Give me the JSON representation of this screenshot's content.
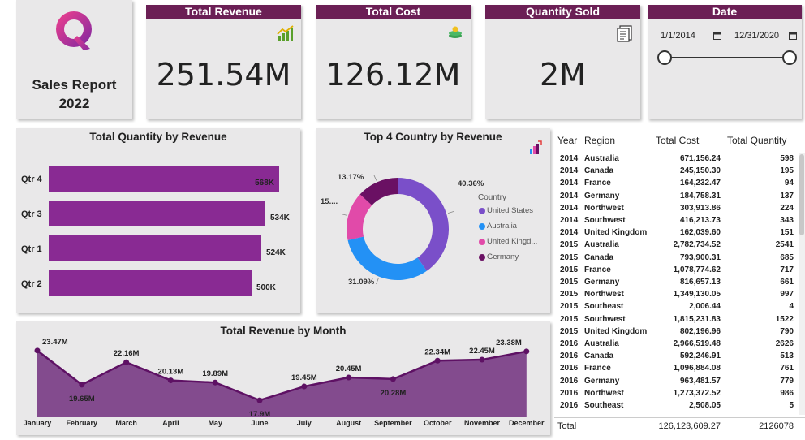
{
  "logo": {
    "title_line1": "Sales Report",
    "title_line2": "2022",
    "colors": [
      "#e43e8f",
      "#8a2a9f"
    ]
  },
  "kpis": {
    "revenue": {
      "label": "Total Revenue",
      "value": "251.54M",
      "icon": "revenue-chart-icon"
    },
    "cost": {
      "label": "Total Cost",
      "value": "126.12M",
      "icon": "coins-icon"
    },
    "quantity": {
      "label": "Quantity Sold",
      "value": "2M",
      "icon": "report-icon"
    }
  },
  "date_filter": {
    "label": "Date",
    "start": "1/1/2014",
    "end": "12/31/2020",
    "range_fraction": [
      0,
      1
    ]
  },
  "colors": {
    "header": "#6b1f55",
    "bar": "#892a93",
    "area": "#7a3d86",
    "line": "#5e1164"
  },
  "bar_chart": {
    "title": "Total Quantity by Revenue",
    "chart_data": {
      "type": "bar",
      "categories": [
        "Qtr 4",
        "Qtr 3",
        "Qtr 1",
        "Qtr 2"
      ],
      "values": [
        568,
        534,
        524,
        500
      ],
      "labels": [
        "568K",
        "534K",
        "524K",
        "500K"
      ],
      "ylabel": "",
      "xlabel": ""
    }
  },
  "donut_chart": {
    "title": "Top 4 Country by Revenue",
    "legend_title": "Country",
    "legend_items": [
      "United States",
      "Australia",
      "United Kingd...",
      "Germany"
    ],
    "labels": [
      "40.36%",
      "31.09%",
      "15....",
      "13.17%"
    ],
    "chart_data": {
      "type": "pie",
      "categories": [
        "United States",
        "Australia",
        "United Kingdom",
        "Germany"
      ],
      "values": [
        40.36,
        31.09,
        15.38,
        13.17
      ],
      "colors": [
        "#7a4fc9",
        "#2391f5",
        "#e14aa9",
        "#6a1063"
      ]
    }
  },
  "line_chart": {
    "title": "Total Revenue by Month",
    "chart_data": {
      "type": "area",
      "categories": [
        "January",
        "February",
        "March",
        "April",
        "May",
        "June",
        "July",
        "August",
        "September",
        "October",
        "November",
        "December"
      ],
      "values": [
        23.47,
        19.65,
        22.16,
        20.13,
        19.89,
        17.9,
        19.45,
        20.45,
        20.28,
        22.34,
        22.45,
        23.38
      ],
      "labels": [
        "23.47M",
        "19.65M",
        "22.16M",
        "20.13M",
        "19.89M",
        "17.9M",
        "19.45M",
        "20.45M",
        "20.28M",
        "22.34M",
        "22.45M",
        "23.38M"
      ]
    }
  },
  "table": {
    "headers": [
      "Year",
      "Region",
      "Total Cost",
      "Total Quantity"
    ],
    "rows": [
      [
        "2014",
        "Australia",
        "671,156.24",
        "598"
      ],
      [
        "2014",
        "Canada",
        "245,150.30",
        "195"
      ],
      [
        "2014",
        "France",
        "164,232.47",
        "94"
      ],
      [
        "2014",
        "Germany",
        "184,758.31",
        "137"
      ],
      [
        "2014",
        "Northwest",
        "303,913.86",
        "224"
      ],
      [
        "2014",
        "Southwest",
        "416,213.73",
        "343"
      ],
      [
        "2014",
        "United Kingdom",
        "162,039.60",
        "151"
      ],
      [
        "2015",
        "Australia",
        "2,782,734.52",
        "2541"
      ],
      [
        "2015",
        "Canada",
        "793,900.31",
        "685"
      ],
      [
        "2015",
        "France",
        "1,078,774.62",
        "717"
      ],
      [
        "2015",
        "Germany",
        "816,657.13",
        "661"
      ],
      [
        "2015",
        "Northwest",
        "1,349,130.05",
        "997"
      ],
      [
        "2015",
        "Southeast",
        "2,006.44",
        "4"
      ],
      [
        "2015",
        "Southwest",
        "1,815,231.83",
        "1522"
      ],
      [
        "2015",
        "United Kingdom",
        "802,196.96",
        "790"
      ],
      [
        "2016",
        "Australia",
        "2,966,519.48",
        "2626"
      ],
      [
        "2016",
        "Canada",
        "592,246.91",
        "513"
      ],
      [
        "2016",
        "France",
        "1,096,884.08",
        "761"
      ],
      [
        "2016",
        "Germany",
        "963,481.57",
        "779"
      ],
      [
        "2016",
        "Northwest",
        "1,273,372.52",
        "986"
      ],
      [
        "2016",
        "Southeast",
        "2,508.05",
        "5"
      ]
    ],
    "total": {
      "label": "Total",
      "cost": "126,123,609.27",
      "quantity": "2126078"
    }
  }
}
